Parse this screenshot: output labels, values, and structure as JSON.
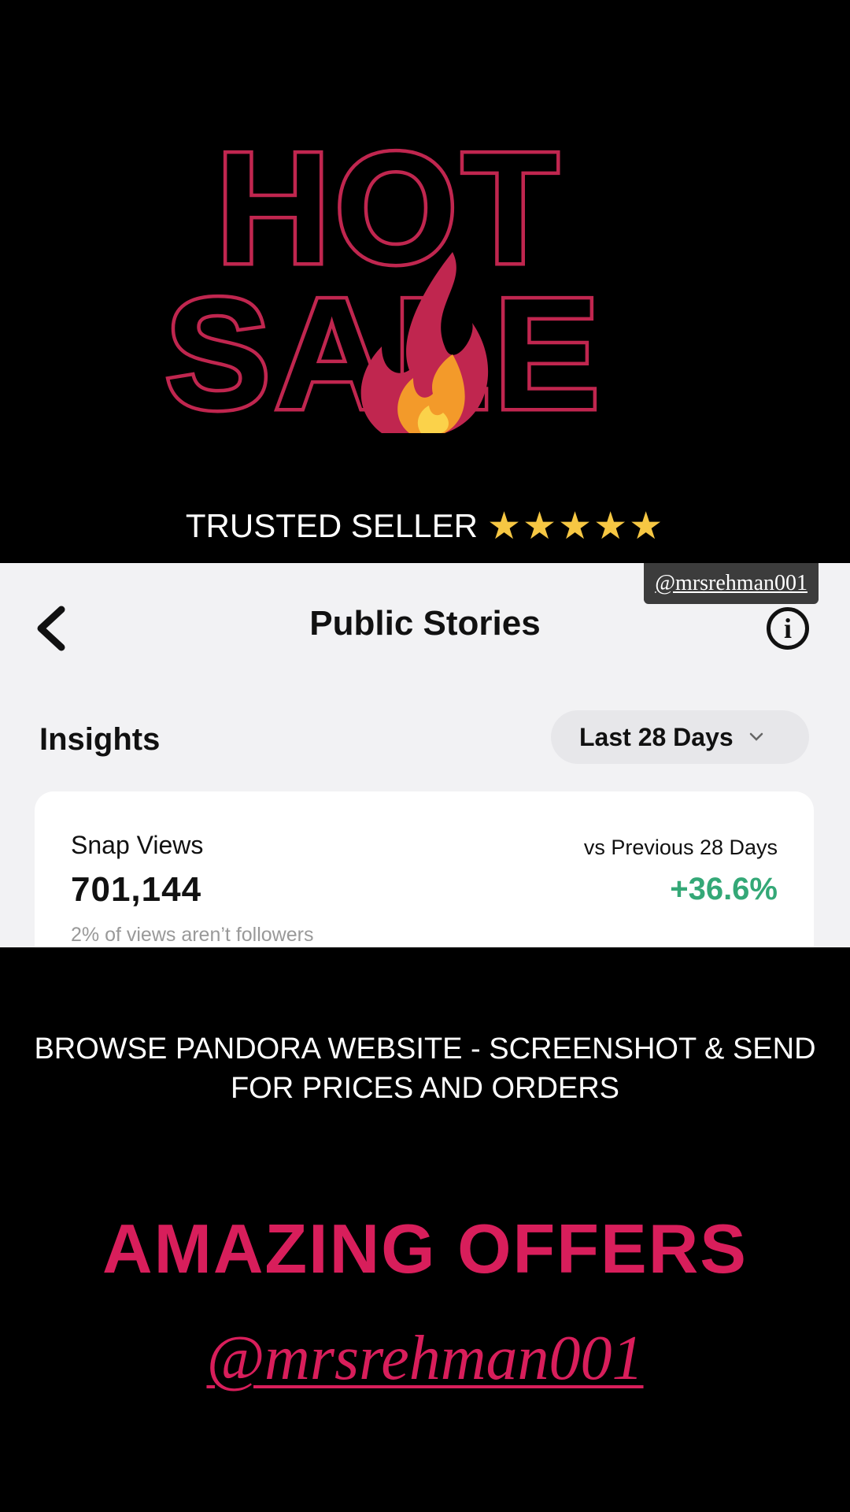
{
  "promo": {
    "logo_line1": "HOT",
    "logo_line2": "SALE",
    "trusted_label": "TRUSTED SELLER",
    "stars": "★★★★★",
    "browse_text": "BROWSE PANDORA WEBSITE - SCREENSHOT & SEND FOR PRICES AND ORDERS",
    "offers_text": "AMAZING OFFERS",
    "handle": "@mrsrehman001"
  },
  "snap": {
    "handle_tag": "@mrsrehman001",
    "title": "Public Stories",
    "back_icon": "chevron-left-icon",
    "info_icon": "info-icon",
    "info_glyph": "i",
    "insights_label": "Insights",
    "period": "Last 28 Days",
    "metric_label": "Snap Views",
    "metric_value": "701,144",
    "metric_note": "2% of views aren’t followers",
    "compare_label": "vs Previous 28 Days",
    "compare_value": "+36.6%"
  },
  "colors": {
    "logo_stroke": "#c0264f",
    "accent_pink": "#d81e5b",
    "star_gold": "#f6c743",
    "positive_green": "#34a877"
  }
}
